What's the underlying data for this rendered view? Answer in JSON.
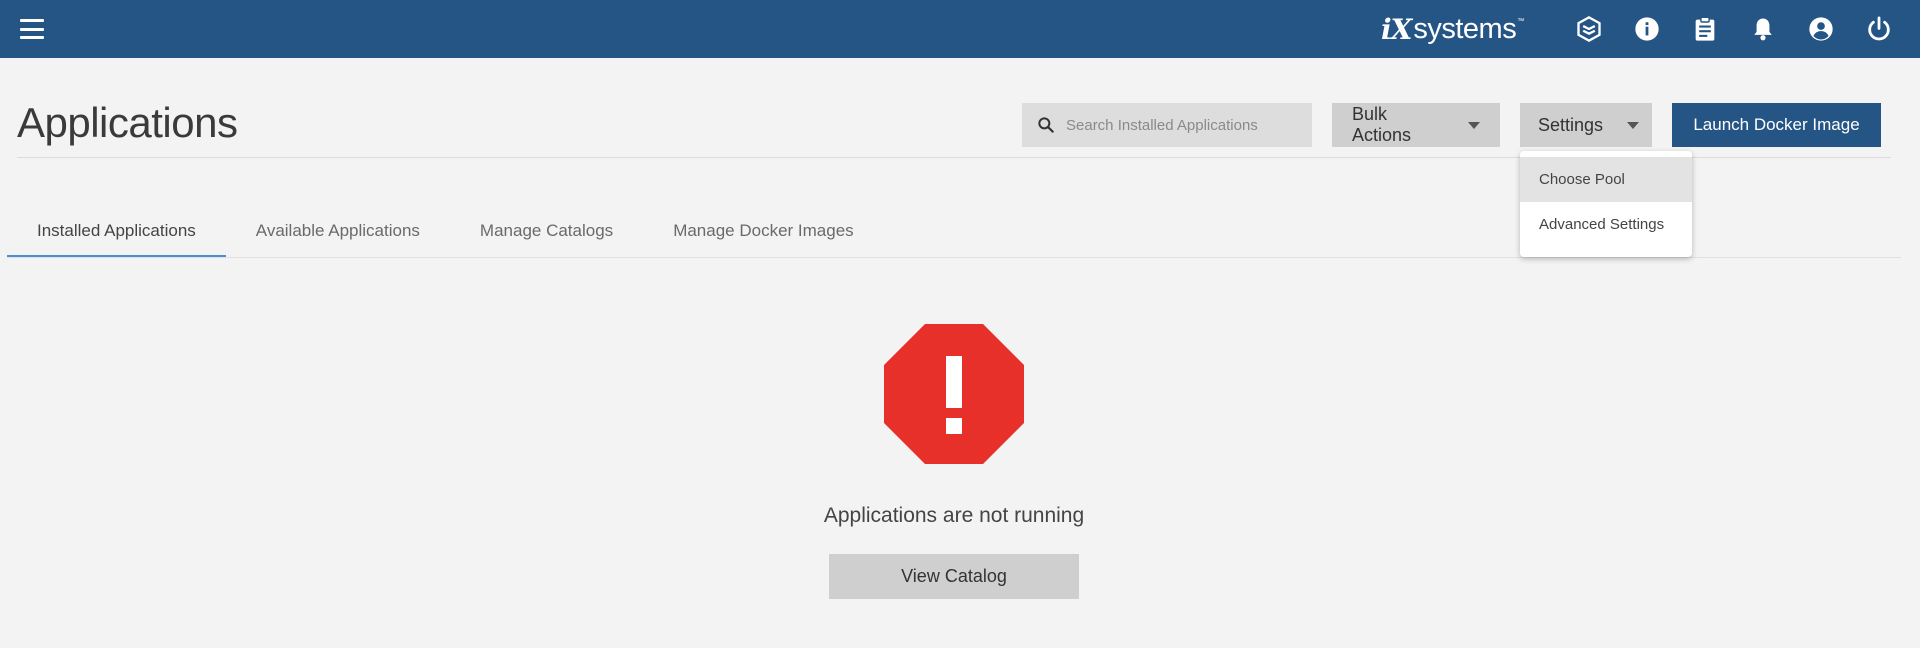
{
  "topbar": {
    "brand": {
      "mark": "iX",
      "name": "systems",
      "tm": "™"
    },
    "icons": [
      {
        "name": "truecommand-icon"
      },
      {
        "name": "info-icon"
      },
      {
        "name": "clipboard-icon"
      },
      {
        "name": "bell-icon"
      },
      {
        "name": "account-icon"
      },
      {
        "name": "power-icon"
      }
    ],
    "color": "#255585"
  },
  "header": {
    "title": "Applications",
    "search": {
      "placeholder": "Search Installed Applications",
      "value": ""
    },
    "bulk_actions_label": "Bulk Actions",
    "settings_label": "Settings",
    "launch_label": "Launch Docker Image"
  },
  "settings_menu": {
    "items": [
      {
        "label": "Choose Pool",
        "highlighted": true
      },
      {
        "label": "Advanced Settings",
        "highlighted": false
      }
    ]
  },
  "tabs": [
    {
      "label": "Installed Applications",
      "active": true
    },
    {
      "label": "Available Applications",
      "active": false
    },
    {
      "label": "Manage Catalogs",
      "active": false
    },
    {
      "label": "Manage Docker Images",
      "active": false
    }
  ],
  "empty_state": {
    "icon": "error-octagon-icon",
    "icon_color": "#e8302b",
    "message": "Applications are not running",
    "action_label": "View Catalog"
  }
}
